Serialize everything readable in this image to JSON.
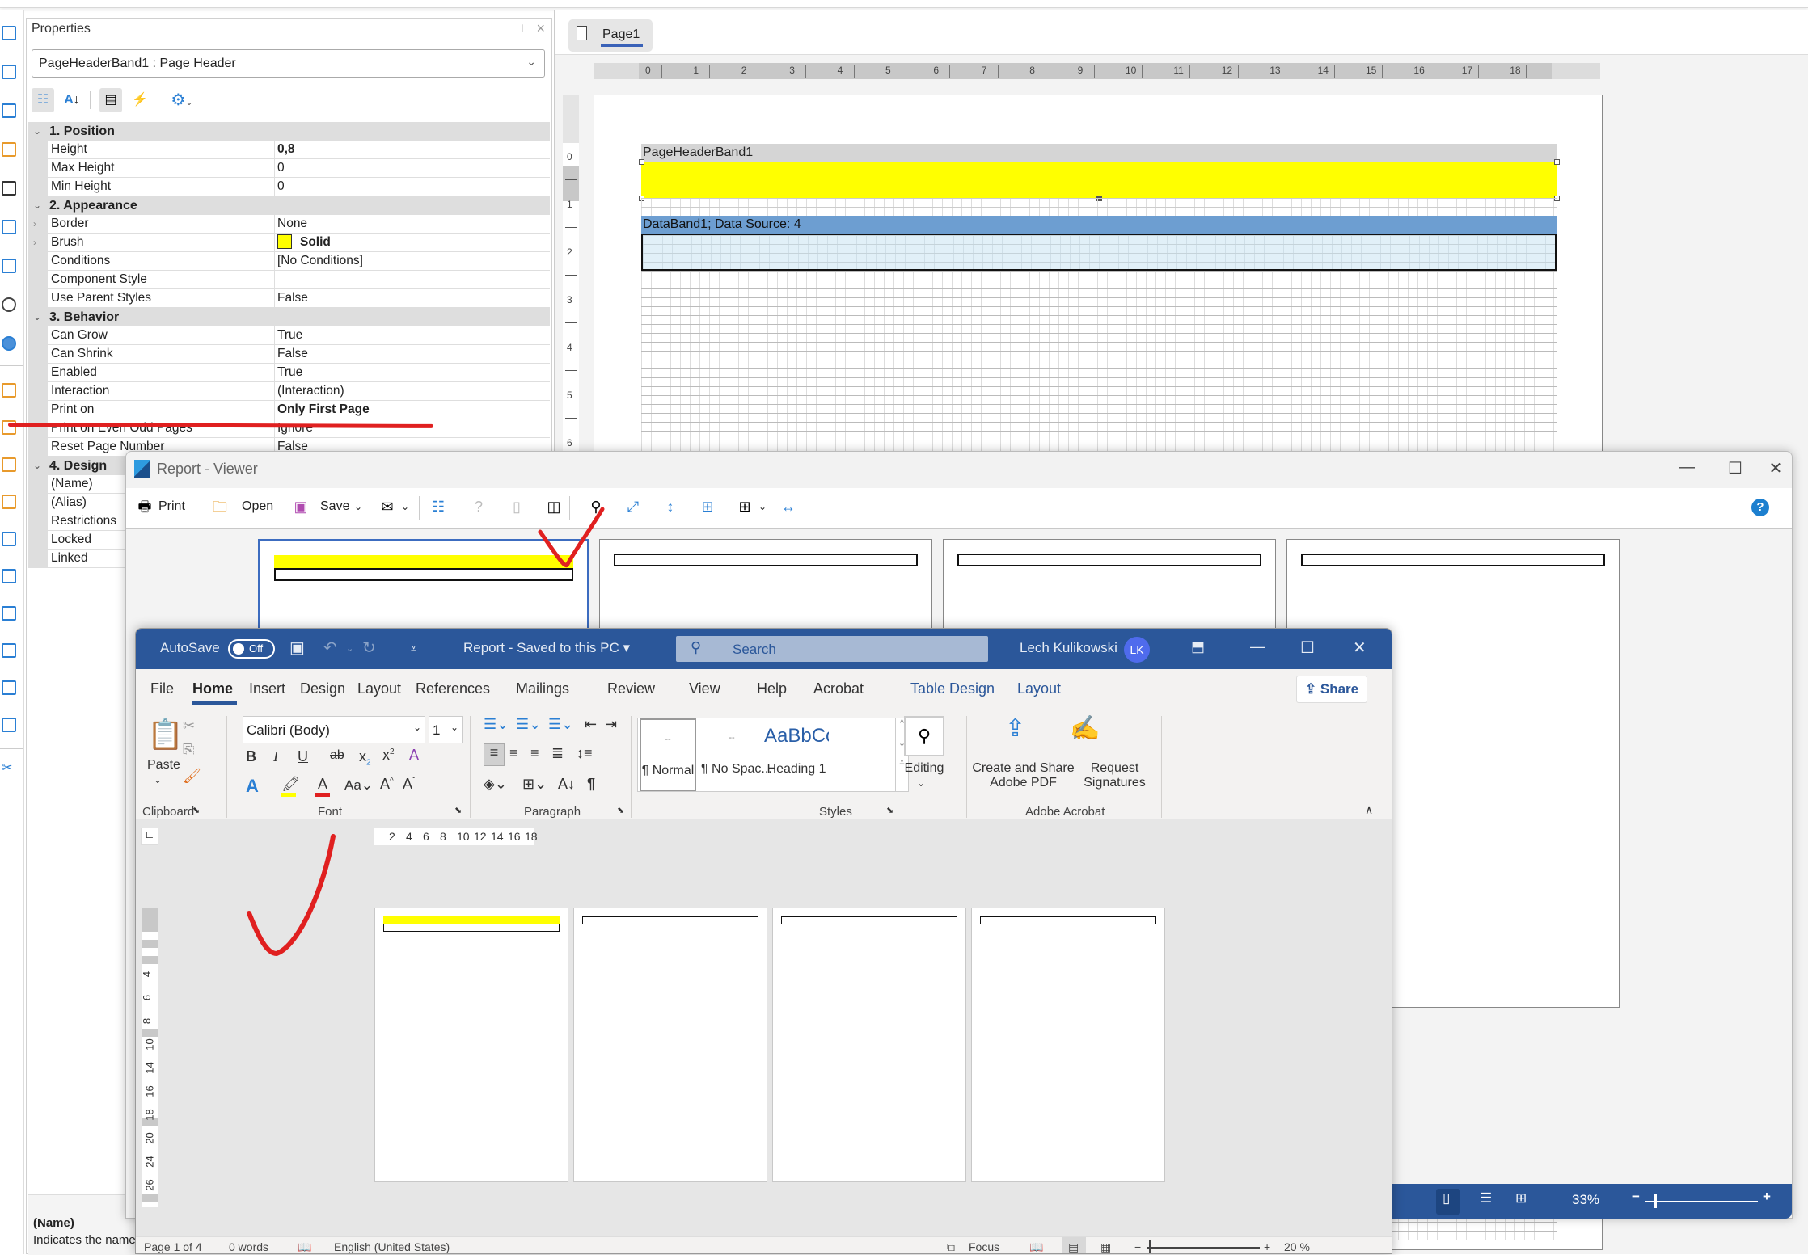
{
  "properties_panel": {
    "title": "Properties",
    "selected_object": "PageHeaderBand1 : Page Header",
    "toolbar": {
      "categorized_icon": "categorized-icon",
      "alphabetical_icon": "sort-az-icon",
      "properties_icon": "properties-list-icon",
      "events_icon": "lightning-icon",
      "settings_icon": "gear-icon"
    },
    "categories": [
      {
        "name": "1. Position",
        "rows": [
          {
            "name": "Height",
            "value": "0,8",
            "bold": true
          },
          {
            "name": "Max Height",
            "value": "0"
          },
          {
            "name": "Min Height",
            "value": "0"
          }
        ]
      },
      {
        "name": "2. Appearance",
        "rows": [
          {
            "name": "Border",
            "value": "None",
            "expandable": true
          },
          {
            "name": "Brush",
            "value": "Solid",
            "bold": true,
            "expandable": true,
            "swatch": "#ffff00"
          },
          {
            "name": "Conditions",
            "value": "[No Conditions]"
          },
          {
            "name": "Component Style",
            "value": ""
          },
          {
            "name": "Use Parent Styles",
            "value": "False"
          }
        ]
      },
      {
        "name": "3. Behavior",
        "rows": [
          {
            "name": "Can Grow",
            "value": "True"
          },
          {
            "name": "Can Shrink",
            "value": "False"
          },
          {
            "name": "Enabled",
            "value": "True"
          },
          {
            "name": "Interaction",
            "value": "(Interaction)"
          },
          {
            "name": "Print on",
            "value": "Only First Page",
            "bold": true
          },
          {
            "name": "Print on Even Odd Pages",
            "value": "Ignore"
          },
          {
            "name": "Reset Page Number",
            "value": "False"
          }
        ]
      },
      {
        "name": "4. Design",
        "rows": [
          {
            "name": "(Name)",
            "value": ""
          },
          {
            "name": "(Alias)",
            "value": ""
          },
          {
            "name": "Restrictions",
            "value": ""
          },
          {
            "name": "Locked",
            "value": ""
          },
          {
            "name": "Linked",
            "value": ""
          }
        ]
      }
    ],
    "description": {
      "title": "(Name)",
      "text": "Indicates the name"
    }
  },
  "designer": {
    "page_tab": "Page1",
    "hruler": [
      "0",
      "1",
      "2",
      "3",
      "4",
      "5",
      "6",
      "7",
      "8",
      "9",
      "10",
      "11",
      "12",
      "13",
      "14",
      "15",
      "16",
      "17",
      "18"
    ],
    "vruler": [
      "0",
      "1",
      "2",
      "3",
      "4",
      "5",
      "6"
    ],
    "bands": {
      "page_header": "PageHeaderBand1",
      "data_band": "DataBand1; Data Source: 4"
    },
    "colors": {
      "page_header_fill": "#ffff00",
      "data_band_header": "#6d9ed1",
      "data_band_body": "#e1f0f8"
    }
  },
  "viewer": {
    "title": "Report - Viewer",
    "toolbar": {
      "print": "Print",
      "open": "Open",
      "save": "Save"
    },
    "page_count": 4,
    "selected_page": 1,
    "status": {
      "zoom": "33%"
    }
  },
  "word": {
    "autosave_label": "AutoSave",
    "autosave_state": "Off",
    "doc_title": "Report  -  Saved to this PC",
    "search_placeholder": "Search",
    "user_name": "Lech Kulikowski",
    "user_initials": "LK",
    "tabs": [
      "File",
      "Home",
      "Insert",
      "Design",
      "Layout",
      "References",
      "Mailings",
      "Review",
      "View",
      "Help",
      "Acrobat",
      "Table Design",
      "Layout"
    ],
    "active_tab": "Home",
    "share_label": "Share",
    "ribbon": {
      "paste": "Paste",
      "font_name": "Calibri (Body)",
      "font_size": "1",
      "styles": [
        "¶ Normal",
        "¶ No Spac...",
        "Heading 1"
      ],
      "heading_preview": "AaBbCc",
      "editing": "Editing",
      "create_share_pdf": "Create and Share Adobe PDF",
      "request_signatures": "Request Signatures",
      "groups": [
        "Clipboard",
        "Font",
        "Paragraph",
        "Styles",
        "Adobe Acrobat"
      ]
    },
    "hruler": [
      "2",
      "4",
      "6",
      "8",
      "10",
      "12",
      "14",
      "16",
      "18"
    ],
    "vruler": [
      "4",
      "6",
      "8",
      "10",
      "14",
      "16",
      "18",
      "20",
      "24",
      "26"
    ],
    "pages": 4,
    "status": {
      "page": "Page 1 of 4",
      "words": "0 words",
      "language": "English (United States)",
      "focus": "Focus",
      "zoom": "20 %"
    }
  }
}
